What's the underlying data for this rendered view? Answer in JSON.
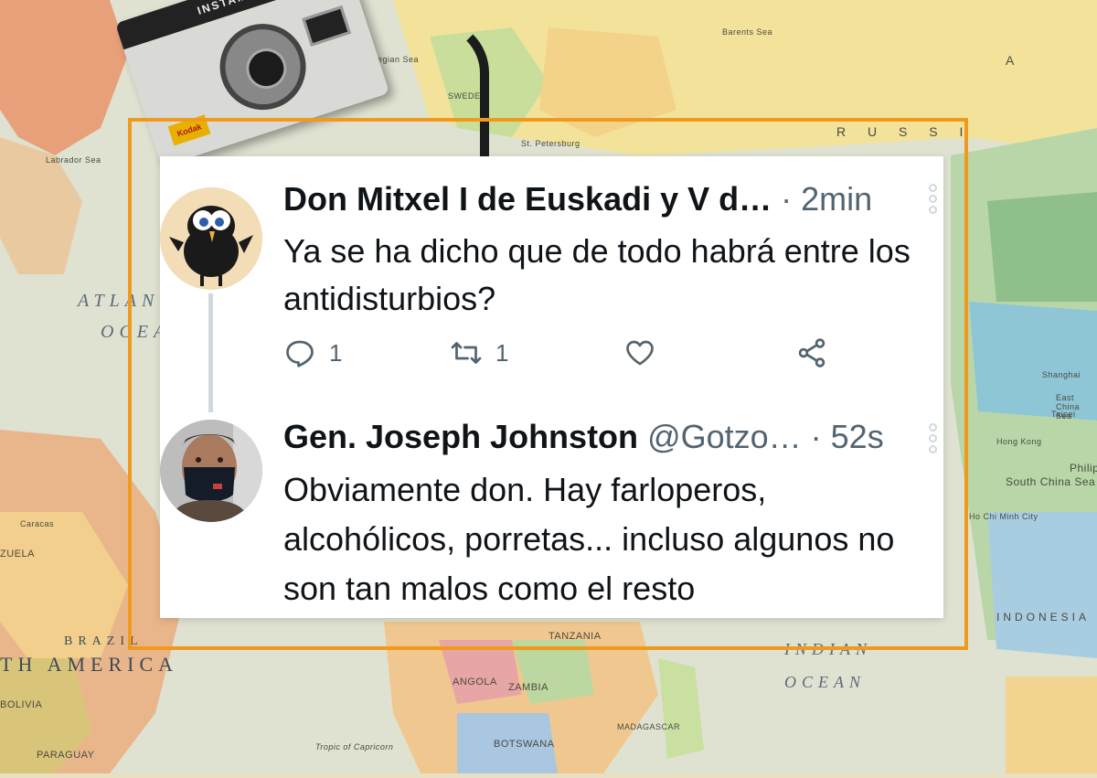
{
  "background": {
    "ocean_labels": [
      "ATLAN",
      "OCEA",
      "INDIAN",
      "OCEAN"
    ],
    "continent_labels": [
      "TH AMERICA",
      "BRAZIL"
    ],
    "place_labels": [
      "Labrador Sea",
      "Barents Sea",
      "Norwegian Sea",
      "SWEDEN",
      "St. Petersburg",
      "R U S S I",
      "A",
      "ANGOLA",
      "ZAMBIA",
      "TANZANIA",
      "BOTSWANA",
      "MADAGASCAR",
      "South China Sea",
      "Philip",
      "Shanghai",
      "East China Sea",
      "Hong Kong",
      "Taipei",
      "Ho Chi Minh City",
      "INDONESIA",
      "BOLIVIA",
      "PARAGUAY",
      "Caracas",
      "ZUELA",
      "Tropic of Capricorn"
    ]
  },
  "camera": {
    "model_text": "INSTAMATIC",
    "brand_badge": "Kodak"
  },
  "tweets": [
    {
      "name": "Don Mitxel I de Euskadi y V d…",
      "handle": "",
      "time": "· 2min",
      "text": "Ya se ha dicho que de todo habrá entre los antidisturbios?",
      "reply_count": "1",
      "retweet_count": "1",
      "avatar_icon": "cartoon-bird-avatar-icon"
    },
    {
      "name": "Gen. Joseph Johnston",
      "handle": "@Gotzo…",
      "time": "· 52s",
      "text": "Obviamente don. Hay farloperos, alcohólicos, porretas... incluso algunos no son tan malos como el resto",
      "avatar_icon": "masked-person-avatar-icon"
    }
  ],
  "colors": {
    "frame": "#f09a1d",
    "text_primary": "#0f1419",
    "text_secondary": "#536471",
    "thread_line": "#cfd9de"
  }
}
